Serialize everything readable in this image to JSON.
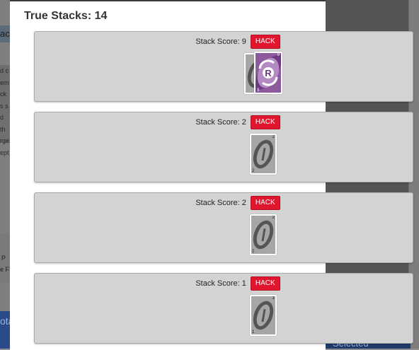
{
  "modal": {
    "title": "True Stacks: 14"
  },
  "background": {
    "left_fragments": [
      "ac",
      "d c",
      "em",
      "ck",
      "s s",
      "d th",
      "rge",
      "ept",
      "P",
      "e F",
      "otal"
    ],
    "bottom_fragment": "Selected"
  },
  "stacks": [
    {
      "score_label": "Stack Score: 9",
      "hack_label": "HACK",
      "cards": [
        {
          "style": "gray",
          "corner": "",
          "icon": "blank-card-icon"
        },
        {
          "style": "purple",
          "corner": "9",
          "icon": "reverse-card-icon",
          "symbol": "R"
        }
      ]
    },
    {
      "score_label": "Stack Score: 2",
      "hack_label": "HACK",
      "cards": [
        {
          "style": "gray",
          "corner": "2",
          "icon": "blank-card-icon"
        }
      ]
    },
    {
      "score_label": "Stack Score: 2",
      "hack_label": "HACK",
      "cards": [
        {
          "style": "gray",
          "corner": "2",
          "icon": "blank-card-icon"
        }
      ]
    },
    {
      "score_label": "Stack Score: 1",
      "hack_label": "HACK",
      "cards": [
        {
          "style": "gray",
          "corner": "1",
          "icon": "blank-card-icon"
        }
      ]
    }
  ],
  "colors": {
    "hack_button": "#e0152e",
    "card_gray": "#a6a6a6",
    "card_purple": "#8e5a9e",
    "panel": "#d3d3d3"
  }
}
